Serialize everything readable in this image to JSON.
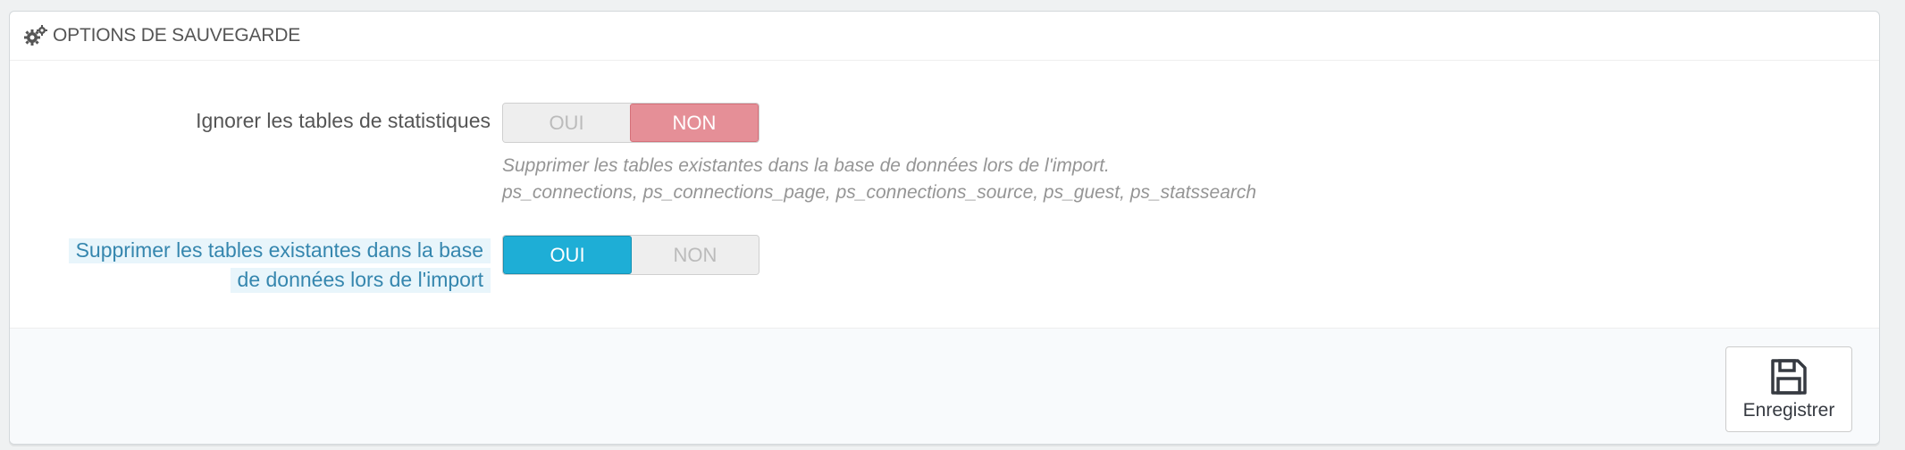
{
  "panel": {
    "title": "OPTIONS DE SAUVEGARDE",
    "icon": "cogs-icon"
  },
  "fields": [
    {
      "label": "Ignorer les tables de statistiques",
      "switch": {
        "yes_label": "OUI",
        "no_label": "NON",
        "selected": "NON"
      },
      "help_line1": "Supprimer les tables existantes dans la base de données lors de l'import.",
      "help_line2": "ps_connections, ps_connections_page, ps_connections_source, ps_guest, ps_statssearch"
    },
    {
      "label_line1": "Supprimer les tables existantes dans la base",
      "label_line2": "de données lors de l'import",
      "switch": {
        "yes_label": "OUI",
        "no_label": "NON",
        "selected": "OUI"
      }
    }
  ],
  "footer": {
    "save_label": "Enregistrer",
    "save_icon": "floppy-disk-icon"
  },
  "colors": {
    "no_active": "#e58f97",
    "yes_active": "#1eaed6",
    "help_label": "#3586ae"
  }
}
